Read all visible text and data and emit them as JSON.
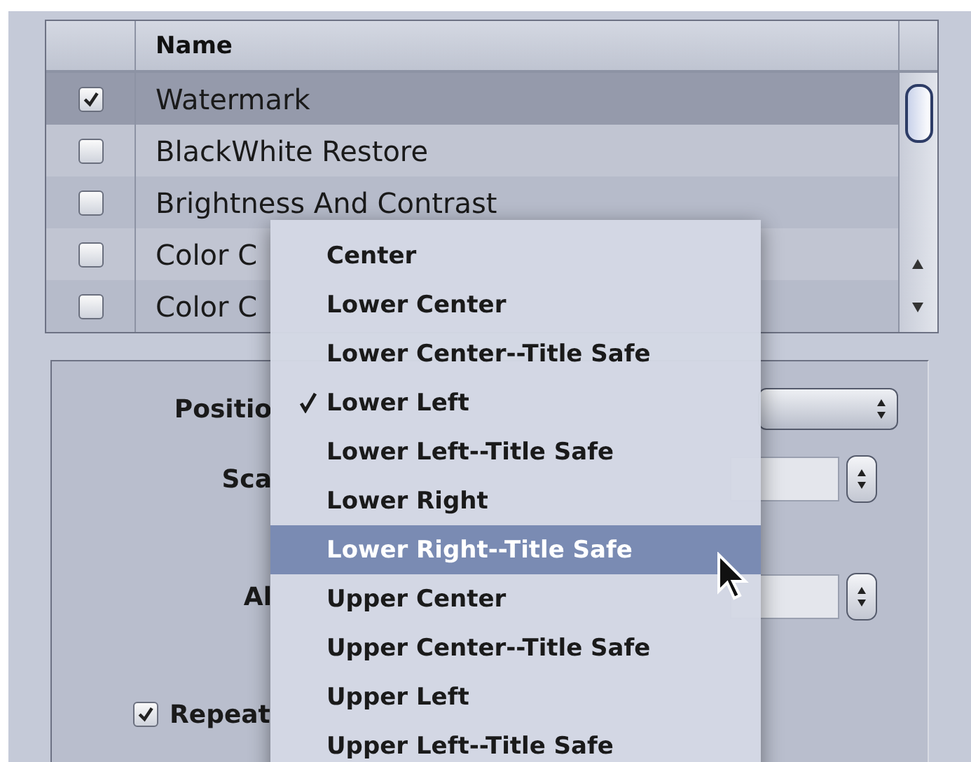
{
  "table": {
    "columns": [
      "Name"
    ],
    "rows": [
      {
        "name": "Watermark",
        "checked": true,
        "selected": true
      },
      {
        "name": "BlackWhite Restore",
        "checked": false,
        "selected": false
      },
      {
        "name": "Brightness And Contrast",
        "checked": false,
        "selected": false
      },
      {
        "name": "Color C",
        "checked": false,
        "selected": false
      },
      {
        "name": "Color C",
        "checked": false,
        "selected": false
      }
    ]
  },
  "panel": {
    "rows": [
      {
        "kind": "popup",
        "label": "Positio"
      },
      {
        "kind": "number",
        "label": "Sca"
      },
      {
        "kind": "number",
        "label": "Al"
      },
      {
        "kind": "checkbox",
        "label": "Repeat",
        "checked": true
      }
    ]
  },
  "menu": {
    "items": [
      {
        "label": "Center",
        "checked": false,
        "selected": false
      },
      {
        "label": "Lower Center",
        "checked": false,
        "selected": false
      },
      {
        "label": "Lower Center--Title Safe",
        "checked": false,
        "selected": false
      },
      {
        "label": "Lower Left",
        "checked": true,
        "selected": false
      },
      {
        "label": "Lower Left--Title Safe",
        "checked": false,
        "selected": false
      },
      {
        "label": "Lower Right",
        "checked": false,
        "selected": false
      },
      {
        "label": "Lower Right--Title Safe",
        "checked": false,
        "selected": true
      },
      {
        "label": "Upper Center",
        "checked": false,
        "selected": false
      },
      {
        "label": "Upper Center--Title Safe",
        "checked": false,
        "selected": false
      },
      {
        "label": "Upper Left",
        "checked": false,
        "selected": false
      },
      {
        "label": "Upper Left--Title Safe",
        "checked": false,
        "selected": false
      }
    ]
  }
}
